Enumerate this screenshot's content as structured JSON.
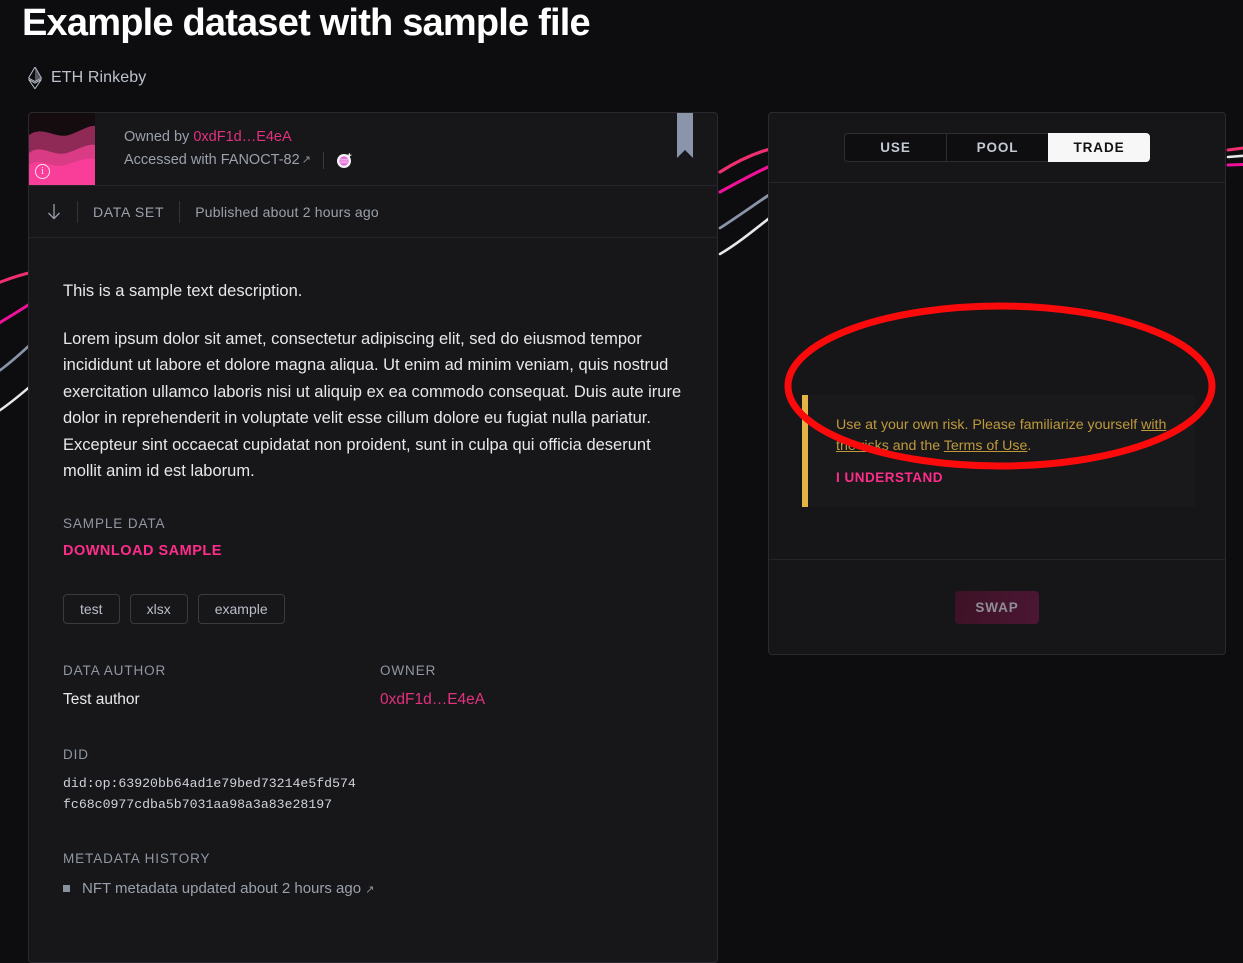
{
  "page": {
    "title": "Example dataset with sample file"
  },
  "network": {
    "icon": "ethereum-icon",
    "label": "ETH Rinkeby"
  },
  "asset": {
    "thumbnail_icon": "nft-waves-thumbnail",
    "info_icon": "info-icon",
    "owned_by_prefix": "Owned by",
    "owner_address": "0xdF1d…E4eA",
    "accessed_prefix": "Accessed with",
    "access_token": "FANOCT-82",
    "external_link_icon": "external-link-icon",
    "add_token_icon": "add-token-to-wallet-icon",
    "bookmark_icon": "bookmark-icon",
    "meta": {
      "download_icon": "download-arrow-icon",
      "type": "DATA SET",
      "published": "Published about 2 hours ago"
    }
  },
  "description": {
    "lead": "This is a sample text description.",
    "body": "Lorem ipsum dolor sit amet, consectetur adipiscing elit, sed do eiusmod tempor incididunt ut labore et dolore magna aliqua. Ut enim ad minim veniam, quis nostrud exercitation ullamco laboris nisi ut aliquip ex ea commodo consequat. Duis aute irure dolor in reprehenderit in voluptate velit esse cillum dolore eu fugiat nulla pariatur. Excepteur sint occaecat cupidatat non proident, sunt in culpa qui officia deserunt mollit anim id est laborum."
  },
  "sample": {
    "label": "SAMPLE DATA",
    "download_label": "DOWNLOAD SAMPLE"
  },
  "tags": [
    "test",
    "xlsx",
    "example"
  ],
  "details": {
    "author_label": "DATA AUTHOR",
    "author_value": "Test author",
    "owner_label": "OWNER",
    "owner_value": "0xdF1d…E4eA",
    "did_label": "DID",
    "did_value": "did:op:63920bb64ad1e79bed73214e5fd574fc68c0977cdba5b7031aa98a3a83e28197"
  },
  "history": {
    "label": "METADATA HISTORY",
    "items": [
      {
        "bullet_icon": "square-bullet-icon",
        "text": "NFT metadata updated about 2 hours ago",
        "link_icon": "external-link-icon"
      }
    ]
  },
  "trade": {
    "tabs": [
      {
        "label": "USE",
        "active": false
      },
      {
        "label": "POOL",
        "active": false
      },
      {
        "label": "TRADE",
        "active": true
      }
    ],
    "notice": {
      "text_part1": "Use at your own risk. Please familiarize yourself ",
      "link1": "with the risks",
      "text_part2": " and the ",
      "link2": "Terms of Use",
      "text_part3": ".",
      "understand_label": "I UNDERSTAND"
    },
    "swap_label": "SWAP"
  },
  "annotation": {
    "shape": "red-ellipse-highlight",
    "color": "#fa0a0a"
  },
  "colors": {
    "background": "#0d0d0f",
    "card": "#17171a",
    "accent_pink": "#ff2d8a",
    "link_pink": "#e2317f",
    "warning_gold": "#e3b445",
    "warning_text": "#bf9a3c",
    "muted_text": "#9aa0ab",
    "annotation_red": "#fa0a0a"
  }
}
